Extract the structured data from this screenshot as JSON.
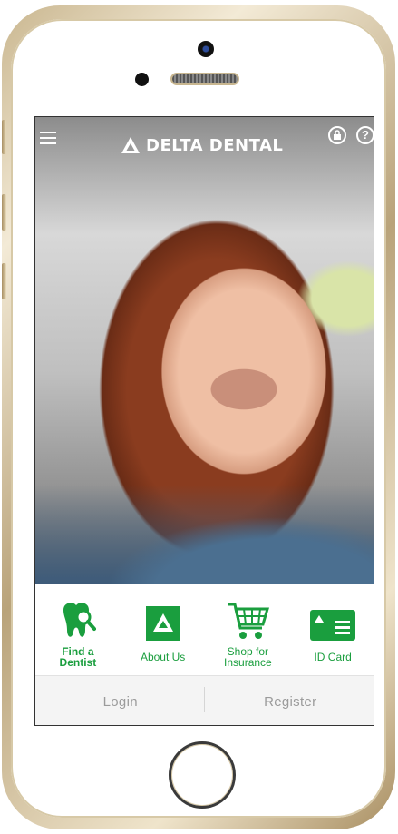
{
  "brand": {
    "logo_text": "DELTA DENTAL",
    "accent": "#1a9e3e"
  },
  "header": {
    "menu_icon": "hamburger-menu-icon",
    "lock_icon": "lock-icon",
    "help_icon": "help-icon",
    "help_glyph": "?"
  },
  "actions": [
    {
      "label_line1": "Find a",
      "label_line2": "Dentist",
      "icon": "tooth-search-icon"
    },
    {
      "label": "About Us",
      "icon": "delta-logo-icon"
    },
    {
      "label_line1": "Shop for",
      "label_line2": "Insurance",
      "icon": "shopping-cart-icon"
    },
    {
      "label": "ID Card",
      "icon": "id-card-icon"
    }
  ],
  "auth": {
    "login_label": "Login",
    "register_label": "Register"
  }
}
